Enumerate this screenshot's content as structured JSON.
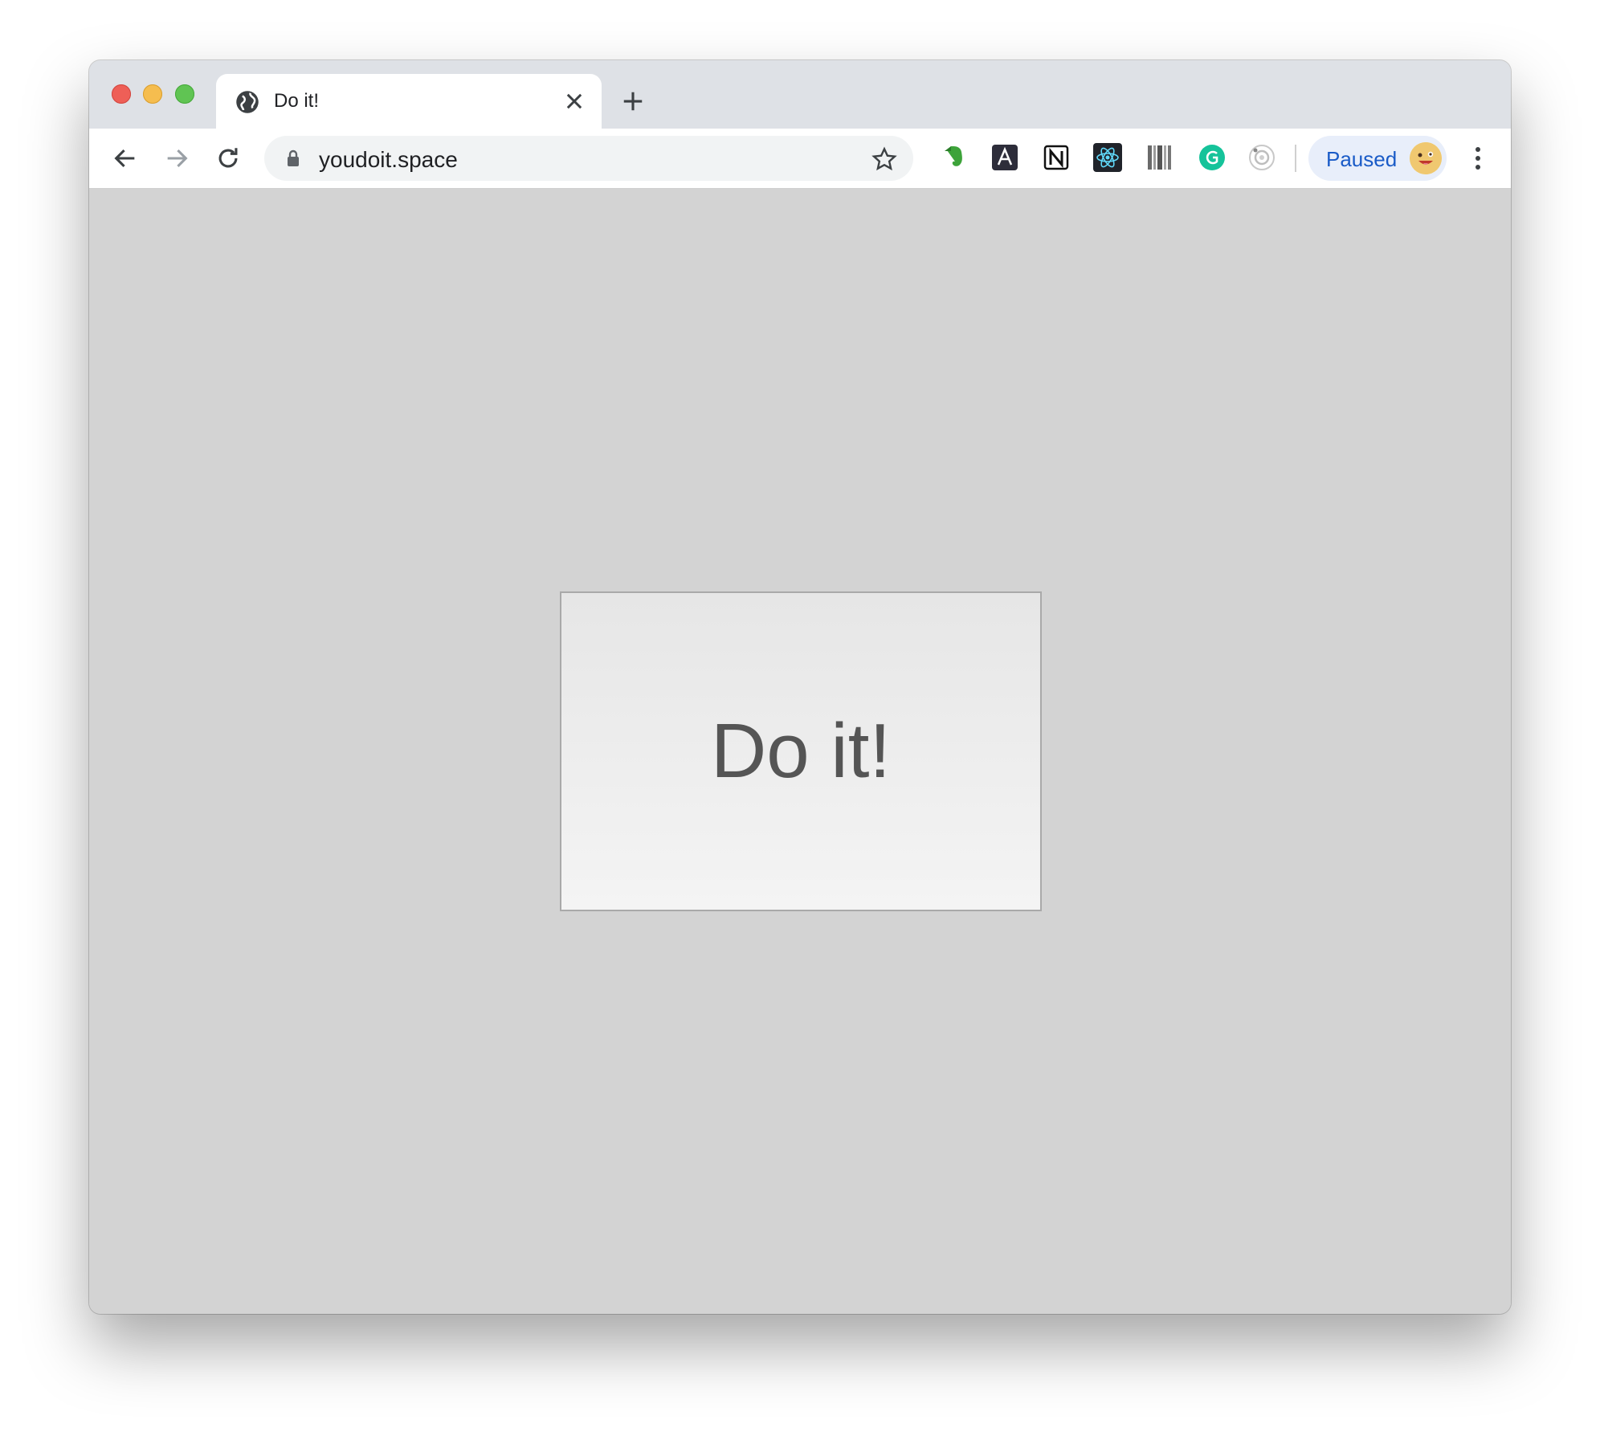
{
  "tab": {
    "title": "Do it!"
  },
  "address_bar": {
    "url": "youdoit.space"
  },
  "profile": {
    "label": "Paused"
  },
  "extensions": [
    "evernote-icon",
    "font-app-icon",
    "notion-icon",
    "react-icon",
    "barcode-icon",
    "grammarly-icon",
    "camera-icon"
  ],
  "page": {
    "button_label": "Do it!"
  },
  "colors": {
    "page_bg": "#d3d3d3",
    "button_text": "#555555",
    "profile_text": "#1a5bc7"
  }
}
